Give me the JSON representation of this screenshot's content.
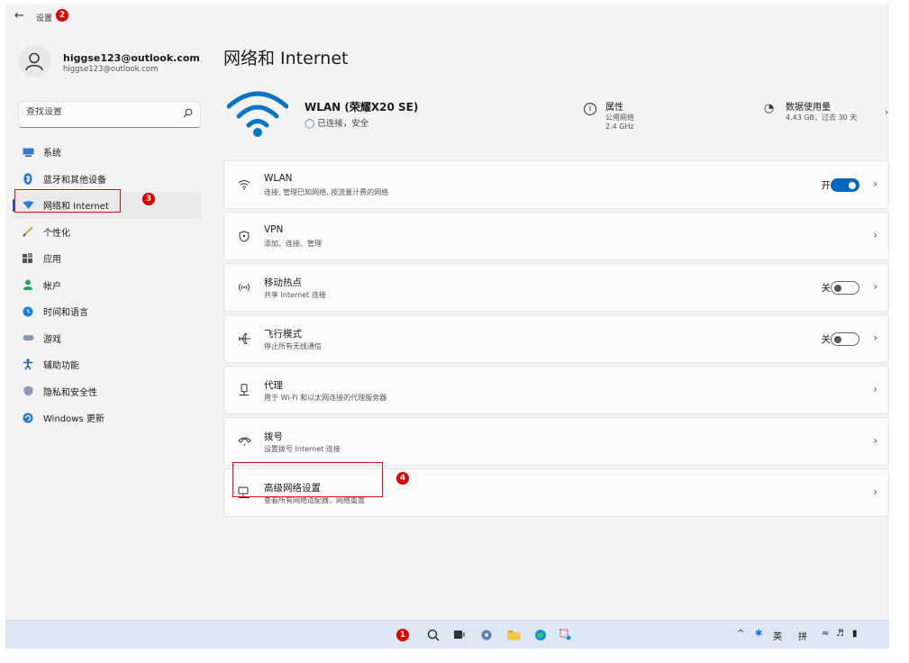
{
  "window": {
    "title": "设置"
  },
  "profile": {
    "name": "higgse123@outlook.com",
    "email": "higgse123@outlook.com"
  },
  "search": {
    "placeholder": "查找设置"
  },
  "sidebar": {
    "items": [
      {
        "label": "系统",
        "icon": "monitor-icon"
      },
      {
        "label": "蓝牙和其他设备",
        "icon": "bluetooth-icon"
      },
      {
        "label": "网络和 Internet",
        "icon": "network-icon",
        "active": true
      },
      {
        "label": "个性化",
        "icon": "brush-icon"
      },
      {
        "label": "应用",
        "icon": "apps-icon"
      },
      {
        "label": "帐户",
        "icon": "account-icon"
      },
      {
        "label": "时间和语言",
        "icon": "clock-globe-icon"
      },
      {
        "label": "游戏",
        "icon": "gamepad-icon"
      },
      {
        "label": "辅助功能",
        "icon": "accessibility-icon"
      },
      {
        "label": "隐私和安全性",
        "icon": "shield-icon"
      },
      {
        "label": "Windows 更新",
        "icon": "update-icon"
      }
    ]
  },
  "main": {
    "title": "网络和 Internet",
    "hero": {
      "ssid": "WLAN (荣耀X20 SE)",
      "status": "已连接，安全",
      "properties": {
        "title": "属性",
        "line1": "公用网络",
        "line2": "2.4 GHz"
      },
      "usage": {
        "title": "数据使用量",
        "detail": "4.43 GB，过去 30 天"
      }
    },
    "cards": [
      {
        "title": "WLAN",
        "subtitle": "连接, 管理已知网络, 按流量计费的网络",
        "icon": "wifi-icon",
        "toggle_label": "开",
        "toggle_on": true
      },
      {
        "title": "VPN",
        "subtitle": "添加、连接、管理",
        "icon": "vpn-shield-icon"
      },
      {
        "title": "移动热点",
        "subtitle": "共享 Internet 连接",
        "icon": "hotspot-icon",
        "toggle_label": "关",
        "toggle_on": false
      },
      {
        "title": "飞行模式",
        "subtitle": "停止所有无线通信",
        "icon": "airplane-icon",
        "toggle_label": "关",
        "toggle_on": false
      },
      {
        "title": "代理",
        "subtitle": "用于 Wi-Fi 和以太网连接的代理服务器",
        "icon": "proxy-icon"
      },
      {
        "title": "拨号",
        "subtitle": "设置拨号 Internet 连接",
        "icon": "dialup-icon"
      },
      {
        "title": "高级网络设置",
        "subtitle": "查看所有网络适配器，网络重置",
        "icon": "network-adapter-icon"
      }
    ]
  },
  "badges": {
    "b1": "1",
    "b2": "2",
    "b3": "3",
    "b4": "4"
  },
  "taskbar": {
    "tray": {
      "chevron": "^",
      "lang": "英",
      "ime": "拼"
    }
  },
  "colors": {
    "accent": "#0067c0",
    "annotation": "#dd1111"
  }
}
